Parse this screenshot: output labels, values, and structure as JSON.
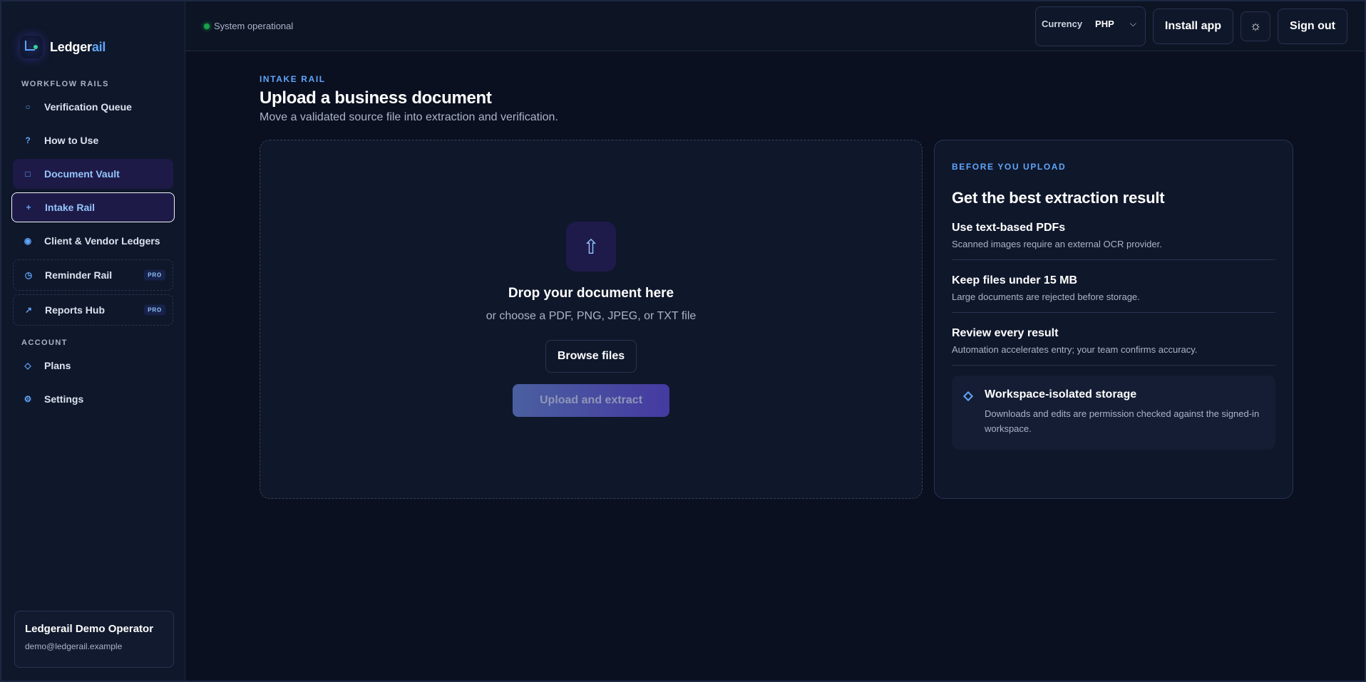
{
  "brand": {
    "name_main": "Ledger",
    "name_accent": "ail",
    "logo_icon": "ledger-logo-icon"
  },
  "sidebar": {
    "section_workflow": "WORKFLOW RAILS",
    "section_account": "ACCOUNT",
    "workflow_items": [
      {
        "label": "Verification Queue",
        "icon": "circle-icon",
        "glyph": "○"
      },
      {
        "label": "How to Use",
        "icon": "question-icon",
        "glyph": "?"
      },
      {
        "label": "Document Vault",
        "icon": "square-icon",
        "glyph": "□"
      },
      {
        "label": "Intake Rail",
        "icon": "plus-icon",
        "glyph": "+"
      },
      {
        "label": "Client & Vendor Ledgers",
        "icon": "ledger-dot-icon",
        "glyph": "◉"
      },
      {
        "label": "Reminder Rail",
        "icon": "clock-icon",
        "glyph": "◷",
        "badge": "PRO"
      },
      {
        "label": "Reports Hub",
        "icon": "arrow-up-right-icon",
        "glyph": "↗",
        "badge": "PRO"
      }
    ],
    "account_items": [
      {
        "label": "Plans",
        "icon": "diamond-icon",
        "glyph": "◇"
      },
      {
        "label": "Settings",
        "icon": "gear-icon",
        "glyph": "⚙"
      }
    ],
    "user": {
      "name": "Ledgerail Demo Operator",
      "email": "demo@ledgerail.example"
    }
  },
  "topbar": {
    "status_text": "System operational",
    "status_color": "#16a34a",
    "currency_label": "Currency",
    "currency_value": "PHP",
    "install_label": "Install app",
    "theme_icon": "sun-icon",
    "theme_glyph": "☼",
    "signout_label": "Sign out"
  },
  "page": {
    "eyebrow": "INTAKE RAIL",
    "title": "Upload a business document",
    "subtitle": "Move a validated source file into extraction and verification."
  },
  "dropzone": {
    "icon": "upload-arrow-icon",
    "glyph": "⇧",
    "title": "Drop your document here",
    "subtitle": "or choose a PDF, PNG, JPEG, or TXT file",
    "browse_label": "Browse files",
    "upload_label": "Upload and extract"
  },
  "tips": {
    "eyebrow": "BEFORE YOU UPLOAD",
    "title": "Get the best extraction result",
    "items": [
      {
        "title": "Use text-based PDFs",
        "desc": "Scanned images require an external OCR provider."
      },
      {
        "title": "Keep files under 15 MB",
        "desc": "Large documents are rejected before storage."
      },
      {
        "title": "Review every result",
        "desc": "Automation accelerates entry; your team confirms accuracy."
      }
    ],
    "note": {
      "icon": "diamond-icon",
      "title": "Workspace-isolated storage",
      "desc": "Downloads and edits are permission checked against the signed-in workspace."
    }
  },
  "colors": {
    "accent": "#60a5fa",
    "active_bg": "#1e1a47",
    "background": "#0a1020"
  }
}
